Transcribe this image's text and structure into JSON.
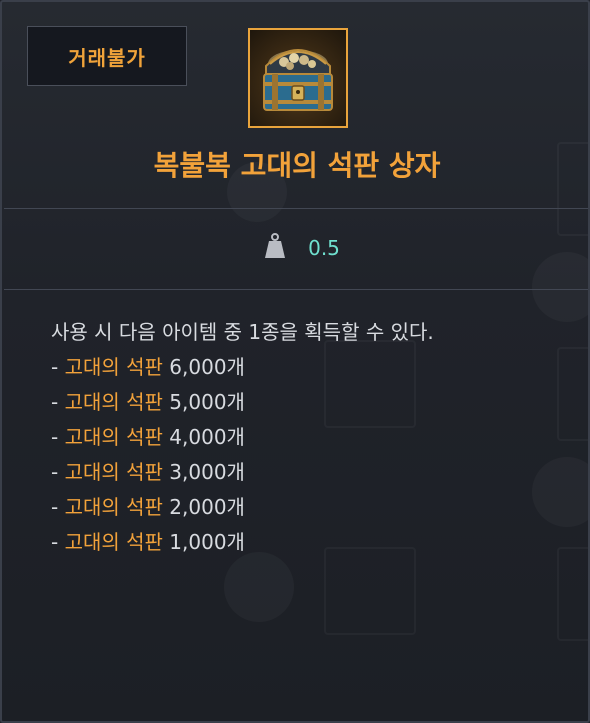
{
  "tooltip": {
    "badge_label": "거래불가",
    "item_name": "복불복 고대의 석판 상자",
    "weight_value": "0.5",
    "description_intro": "사용 시 다음 아이템 중 1종을 획득할 수 있다.",
    "rewards": [
      {
        "prefix": "- ",
        "item": "고대의 석판",
        "amount": "6,000개"
      },
      {
        "prefix": "- ",
        "item": "고대의 석판",
        "amount": "5,000개"
      },
      {
        "prefix": "- ",
        "item": "고대의 석판",
        "amount": "4,000개"
      },
      {
        "prefix": "- ",
        "item": "고대의 석판",
        "amount": "3,000개"
      },
      {
        "prefix": "- ",
        "item": "고대의 석판",
        "amount": "2,000개"
      },
      {
        "prefix": "- ",
        "item": "고대의 석판",
        "amount": "1,000개"
      }
    ],
    "icons": {
      "item": "treasure-chest-icon",
      "weight": "weight-icon"
    },
    "colors": {
      "accent_orange": "#f2a23a",
      "weight_teal": "#6fe0cf",
      "text": "#d8dbe0",
      "background": "#20232a"
    }
  }
}
